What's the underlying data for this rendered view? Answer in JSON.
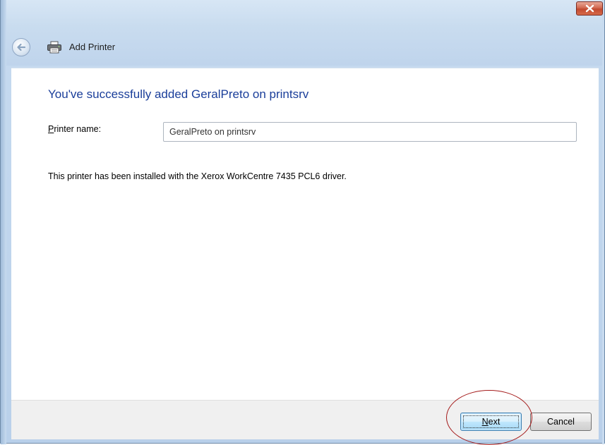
{
  "window": {
    "title": "Add Printer",
    "close_icon": "close-icon",
    "back_icon": "back-arrow-icon",
    "printer_icon": "printer-icon"
  },
  "content": {
    "heading": "You've successfully added GeralPreto on printsrv",
    "printer_name_label_accel": "P",
    "printer_name_label_rest": "rinter name:",
    "printer_name_value": "GeralPreto on printsrv",
    "driver_message": "This printer has been installed with the Xerox WorkCentre 7435 PCL6 driver."
  },
  "footer": {
    "next_accel": "N",
    "next_rest": "ext",
    "cancel_label": "Cancel"
  },
  "colors": {
    "heading": "#1a3e9a",
    "annotation_circle": "#a41a1a"
  }
}
